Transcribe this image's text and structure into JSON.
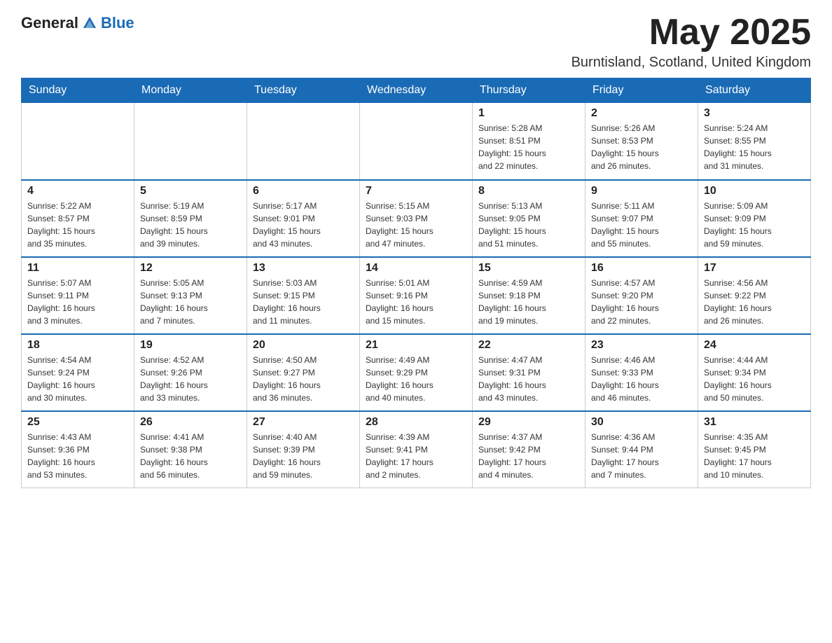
{
  "header": {
    "logo_general": "General",
    "logo_blue": "Blue",
    "month_title": "May 2025",
    "location": "Burntisland, Scotland, United Kingdom"
  },
  "days_of_week": [
    "Sunday",
    "Monday",
    "Tuesday",
    "Wednesday",
    "Thursday",
    "Friday",
    "Saturday"
  ],
  "weeks": [
    [
      {
        "day": "",
        "info": ""
      },
      {
        "day": "",
        "info": ""
      },
      {
        "day": "",
        "info": ""
      },
      {
        "day": "",
        "info": ""
      },
      {
        "day": "1",
        "info": "Sunrise: 5:28 AM\nSunset: 8:51 PM\nDaylight: 15 hours\nand 22 minutes."
      },
      {
        "day": "2",
        "info": "Sunrise: 5:26 AM\nSunset: 8:53 PM\nDaylight: 15 hours\nand 26 minutes."
      },
      {
        "day": "3",
        "info": "Sunrise: 5:24 AM\nSunset: 8:55 PM\nDaylight: 15 hours\nand 31 minutes."
      }
    ],
    [
      {
        "day": "4",
        "info": "Sunrise: 5:22 AM\nSunset: 8:57 PM\nDaylight: 15 hours\nand 35 minutes."
      },
      {
        "day": "5",
        "info": "Sunrise: 5:19 AM\nSunset: 8:59 PM\nDaylight: 15 hours\nand 39 minutes."
      },
      {
        "day": "6",
        "info": "Sunrise: 5:17 AM\nSunset: 9:01 PM\nDaylight: 15 hours\nand 43 minutes."
      },
      {
        "day": "7",
        "info": "Sunrise: 5:15 AM\nSunset: 9:03 PM\nDaylight: 15 hours\nand 47 minutes."
      },
      {
        "day": "8",
        "info": "Sunrise: 5:13 AM\nSunset: 9:05 PM\nDaylight: 15 hours\nand 51 minutes."
      },
      {
        "day": "9",
        "info": "Sunrise: 5:11 AM\nSunset: 9:07 PM\nDaylight: 15 hours\nand 55 minutes."
      },
      {
        "day": "10",
        "info": "Sunrise: 5:09 AM\nSunset: 9:09 PM\nDaylight: 15 hours\nand 59 minutes."
      }
    ],
    [
      {
        "day": "11",
        "info": "Sunrise: 5:07 AM\nSunset: 9:11 PM\nDaylight: 16 hours\nand 3 minutes."
      },
      {
        "day": "12",
        "info": "Sunrise: 5:05 AM\nSunset: 9:13 PM\nDaylight: 16 hours\nand 7 minutes."
      },
      {
        "day": "13",
        "info": "Sunrise: 5:03 AM\nSunset: 9:15 PM\nDaylight: 16 hours\nand 11 minutes."
      },
      {
        "day": "14",
        "info": "Sunrise: 5:01 AM\nSunset: 9:16 PM\nDaylight: 16 hours\nand 15 minutes."
      },
      {
        "day": "15",
        "info": "Sunrise: 4:59 AM\nSunset: 9:18 PM\nDaylight: 16 hours\nand 19 minutes."
      },
      {
        "day": "16",
        "info": "Sunrise: 4:57 AM\nSunset: 9:20 PM\nDaylight: 16 hours\nand 22 minutes."
      },
      {
        "day": "17",
        "info": "Sunrise: 4:56 AM\nSunset: 9:22 PM\nDaylight: 16 hours\nand 26 minutes."
      }
    ],
    [
      {
        "day": "18",
        "info": "Sunrise: 4:54 AM\nSunset: 9:24 PM\nDaylight: 16 hours\nand 30 minutes."
      },
      {
        "day": "19",
        "info": "Sunrise: 4:52 AM\nSunset: 9:26 PM\nDaylight: 16 hours\nand 33 minutes."
      },
      {
        "day": "20",
        "info": "Sunrise: 4:50 AM\nSunset: 9:27 PM\nDaylight: 16 hours\nand 36 minutes."
      },
      {
        "day": "21",
        "info": "Sunrise: 4:49 AM\nSunset: 9:29 PM\nDaylight: 16 hours\nand 40 minutes."
      },
      {
        "day": "22",
        "info": "Sunrise: 4:47 AM\nSunset: 9:31 PM\nDaylight: 16 hours\nand 43 minutes."
      },
      {
        "day": "23",
        "info": "Sunrise: 4:46 AM\nSunset: 9:33 PM\nDaylight: 16 hours\nand 46 minutes."
      },
      {
        "day": "24",
        "info": "Sunrise: 4:44 AM\nSunset: 9:34 PM\nDaylight: 16 hours\nand 50 minutes."
      }
    ],
    [
      {
        "day": "25",
        "info": "Sunrise: 4:43 AM\nSunset: 9:36 PM\nDaylight: 16 hours\nand 53 minutes."
      },
      {
        "day": "26",
        "info": "Sunrise: 4:41 AM\nSunset: 9:38 PM\nDaylight: 16 hours\nand 56 minutes."
      },
      {
        "day": "27",
        "info": "Sunrise: 4:40 AM\nSunset: 9:39 PM\nDaylight: 16 hours\nand 59 minutes."
      },
      {
        "day": "28",
        "info": "Sunrise: 4:39 AM\nSunset: 9:41 PM\nDaylight: 17 hours\nand 2 minutes."
      },
      {
        "day": "29",
        "info": "Sunrise: 4:37 AM\nSunset: 9:42 PM\nDaylight: 17 hours\nand 4 minutes."
      },
      {
        "day": "30",
        "info": "Sunrise: 4:36 AM\nSunset: 9:44 PM\nDaylight: 17 hours\nand 7 minutes."
      },
      {
        "day": "31",
        "info": "Sunrise: 4:35 AM\nSunset: 9:45 PM\nDaylight: 17 hours\nand 10 minutes."
      }
    ]
  ]
}
